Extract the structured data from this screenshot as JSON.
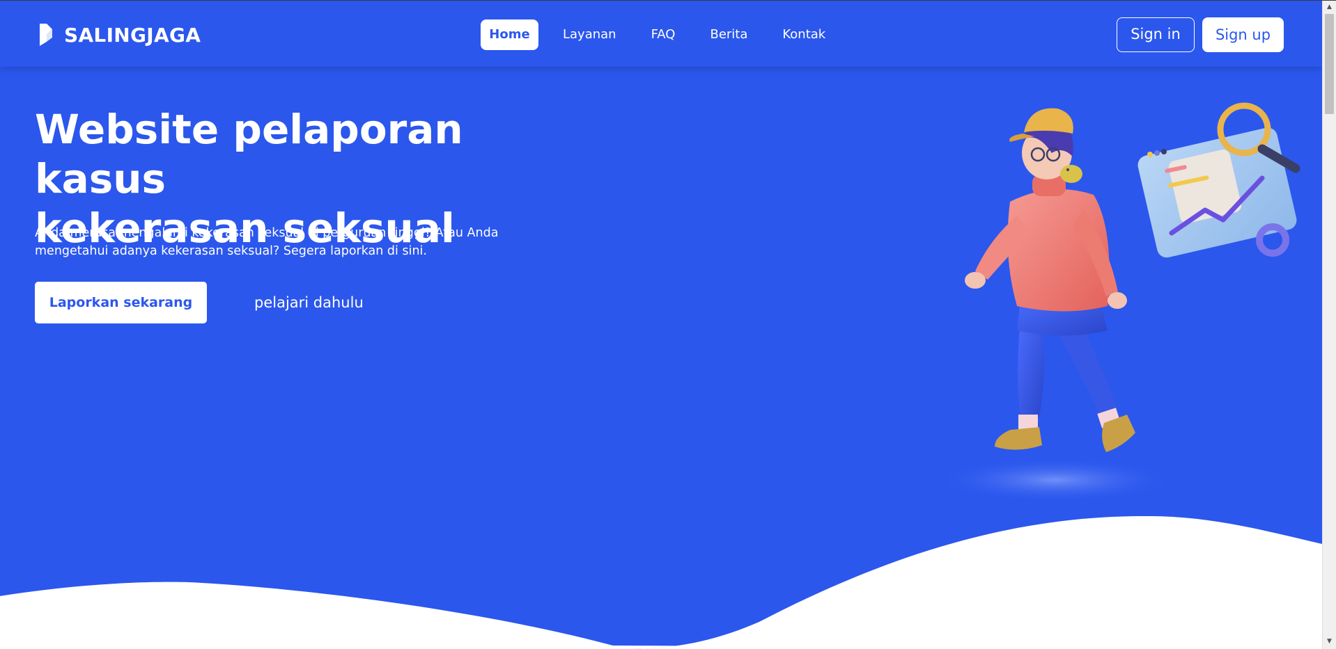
{
  "brand": {
    "name": "SALINGJAGA",
    "icon": "logo-icon"
  },
  "nav": {
    "items": [
      {
        "label": "Home",
        "active": true
      },
      {
        "label": "Layanan",
        "active": false
      },
      {
        "label": "FAQ",
        "active": false
      },
      {
        "label": "Berita",
        "active": false
      },
      {
        "label": "Kontak",
        "active": false
      }
    ]
  },
  "auth": {
    "signin_label": "Sign in",
    "signup_label": "Sign up"
  },
  "hero": {
    "title_line1": "Website pelaporan kasus",
    "title_line2": "kekerasan seksual",
    "description": "Anda merasa mengalami kekerasan seksual di perguruan tinggi? Atau Anda mengetahui adanya kekerasan seksual? Segera laporkan di sini.",
    "primary_cta": "Laporkan sekarang",
    "secondary_cta": "pelajari dahulu"
  },
  "colors": {
    "brand_blue": "#2b57ed",
    "white": "#ffffff"
  },
  "scrollbar": {
    "up_icon": "chevron-up-icon",
    "down_icon": "chevron-down-icon"
  }
}
